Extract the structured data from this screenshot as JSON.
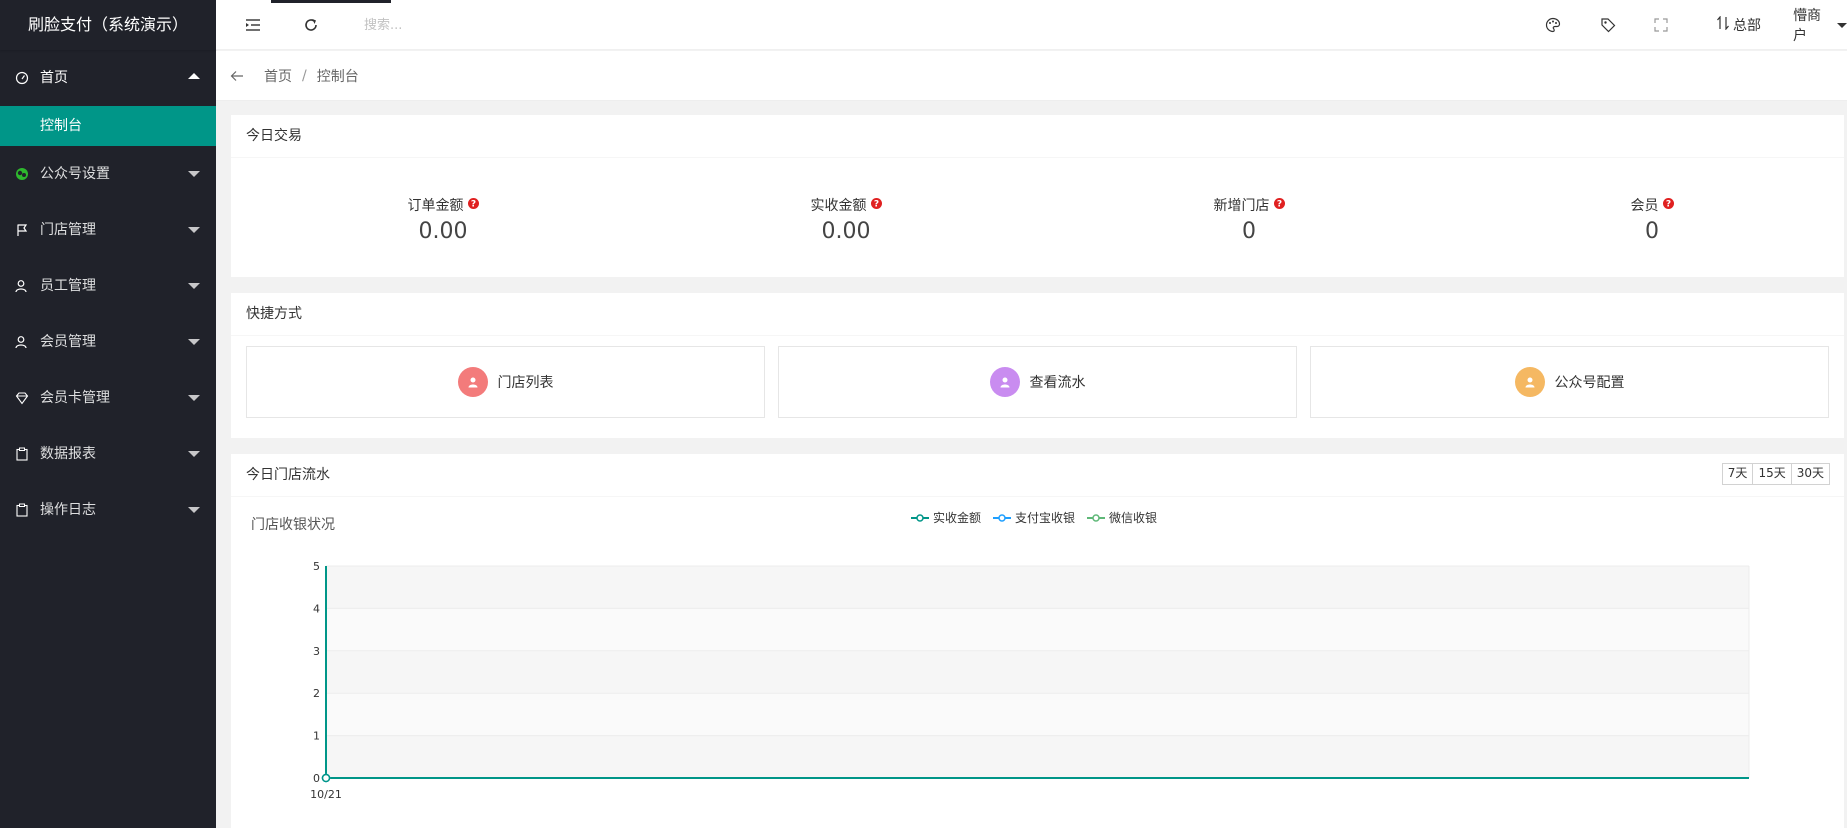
{
  "app": {
    "title": "刷脸支付（系统演示）"
  },
  "sidebar": {
    "items": [
      {
        "label": "首页",
        "icon": "gauge-icon",
        "open": true
      },
      {
        "label": "公众号设置",
        "icon": "wechat-icon"
      },
      {
        "label": "门店管理",
        "icon": "flag-icon"
      },
      {
        "label": "员工管理",
        "icon": "user-icon"
      },
      {
        "label": "会员管理",
        "icon": "user-icon"
      },
      {
        "label": "会员卡管理",
        "icon": "diamond-icon"
      },
      {
        "label": "数据报表",
        "icon": "clipboard-icon"
      },
      {
        "label": "操作日志",
        "icon": "clipboard-icon"
      }
    ],
    "sub_items": [
      {
        "label": "控制台"
      }
    ]
  },
  "header": {
    "search_placeholder": "搜索...",
    "org_label": "总部",
    "merchant_label": "懵商户"
  },
  "breadcrumb": {
    "home": "首页",
    "sep": "/",
    "current": "控制台"
  },
  "today": {
    "title": "今日交易",
    "stats": [
      {
        "label": "订单金额",
        "value": "0.00"
      },
      {
        "label": "实收金额",
        "value": "0.00"
      },
      {
        "label": "新增门店",
        "value": "0"
      },
      {
        "label": "会员",
        "value": "0"
      }
    ]
  },
  "shortcuts": {
    "title": "快捷方式",
    "items": [
      {
        "label": "门店列表",
        "color": "#f37b7b"
      },
      {
        "label": "查看流水",
        "color": "#c98cf0"
      },
      {
        "label": "公众号配置",
        "color": "#f5b862"
      }
    ]
  },
  "flow": {
    "title": "今日门店流水",
    "ranges": [
      "7天",
      "15天",
      "30天"
    ],
    "chart_title": "门店收银状况"
  },
  "colors": {
    "accent": "#009688",
    "sidebar_bg": "#20222a"
  },
  "chart_data": {
    "type": "line",
    "categories": [
      "10/21"
    ],
    "series": [
      {
        "name": "实收金额",
        "values": [
          0
        ],
        "color": "#009688"
      },
      {
        "name": "支付宝收银",
        "values": [
          0
        ],
        "color": "#1e9fff"
      },
      {
        "name": "微信收银",
        "values": [
          0
        ],
        "color": "#5fb878"
      }
    ],
    "ylim": [
      0,
      5
    ],
    "yticks": [
      0,
      1,
      2,
      3,
      4,
      5
    ],
    "grid": true,
    "legend": "top-center"
  }
}
